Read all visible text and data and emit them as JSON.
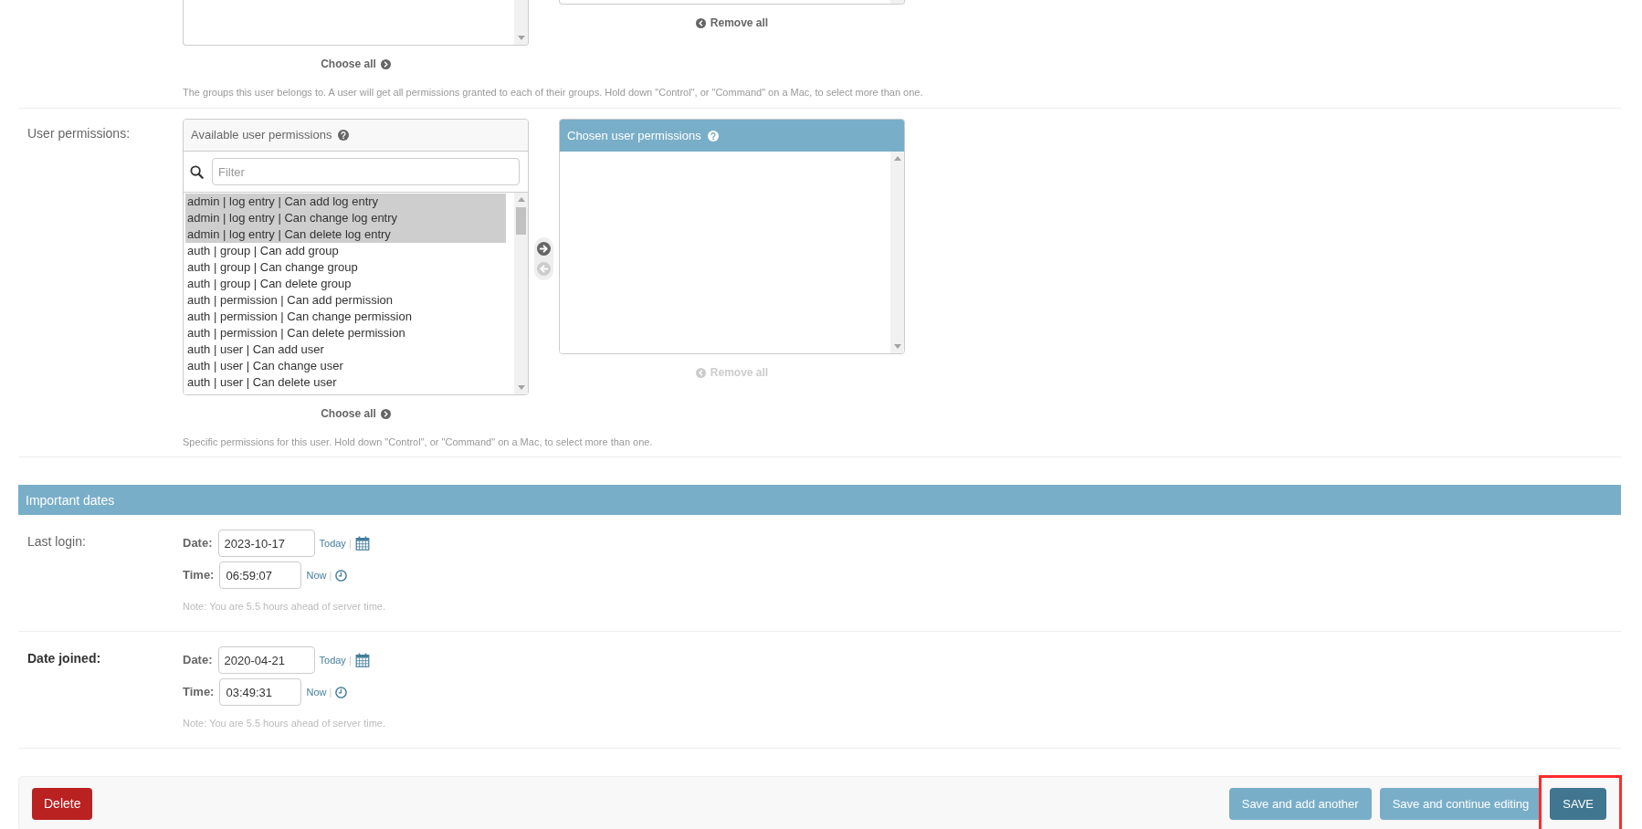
{
  "groups": {
    "choose_all": {
      "label": "Choose all",
      "disabled": false
    },
    "remove_all": {
      "label": "Remove all",
      "disabled": false
    },
    "help_text": "The groups this user belongs to. A user will get all permissions granted to each of their groups. Hold down \"Control\", or \"Command\" on a Mac, to select more than one."
  },
  "user_permissions": {
    "label": "User permissions:",
    "available": {
      "title": "Available user permissions",
      "filter": {
        "placeholder": "Filter"
      },
      "options": [
        {
          "text": "admin | log entry | Can add log entry",
          "selected": true
        },
        {
          "text": "admin | log entry | Can change log entry",
          "selected": true
        },
        {
          "text": "admin | log entry | Can delete log entry",
          "selected": true
        },
        {
          "text": "auth | group | Can add group",
          "selected": false
        },
        {
          "text": "auth | group | Can change group",
          "selected": false
        },
        {
          "text": "auth | group | Can delete group",
          "selected": false
        },
        {
          "text": "auth | permission | Can add permission",
          "selected": false
        },
        {
          "text": "auth | permission | Can change permission",
          "selected": false
        },
        {
          "text": "auth | permission | Can delete permission",
          "selected": false
        },
        {
          "text": "auth | user | Can add user",
          "selected": false
        },
        {
          "text": "auth | user | Can change user",
          "selected": false
        },
        {
          "text": "auth | user | Can delete user",
          "selected": false
        }
      ]
    },
    "chosen": {
      "title": "Chosen user permissions"
    },
    "choose_arrow": {
      "disabled": false
    },
    "remove_arrow": {
      "disabled": true
    },
    "choose_all": {
      "label": "Choose all",
      "disabled": false
    },
    "remove_all": {
      "label": "Remove all",
      "disabled": true
    },
    "help_text": "Specific permissions for this user. Hold down \"Control\", or \"Command\" on a Mac, to select more than one."
  },
  "important_dates": {
    "title": "Important dates",
    "fields": [
      {
        "label": "Last login:",
        "required": false,
        "date": {
          "label": "Date:",
          "value": "2023-10-17",
          "shortcut": "Today",
          "separator": "|"
        },
        "time": {
          "label": "Time:",
          "value": "06:59:07",
          "shortcut": "Now",
          "separator": "|"
        },
        "note": "Note: You are 5.5 hours ahead of server time."
      },
      {
        "label": "Date joined:",
        "required": true,
        "date": {
          "label": "Date:",
          "value": "2020-04-21",
          "shortcut": "Today",
          "separator": "|"
        },
        "time": {
          "label": "Time:",
          "value": "03:49:31",
          "shortcut": "Now",
          "separator": "|"
        },
        "note": "Note: You are 5.5 hours ahead of server time."
      }
    ]
  },
  "submit_row": {
    "delete": "Delete",
    "buttons": [
      {
        "label": "Save and add another",
        "kind": "secondary",
        "highlighted": false
      },
      {
        "label": "Save and continue editing",
        "kind": "secondary",
        "highlighted": false
      },
      {
        "label": "SAVE",
        "kind": "primary",
        "highlighted": true
      }
    ]
  }
}
